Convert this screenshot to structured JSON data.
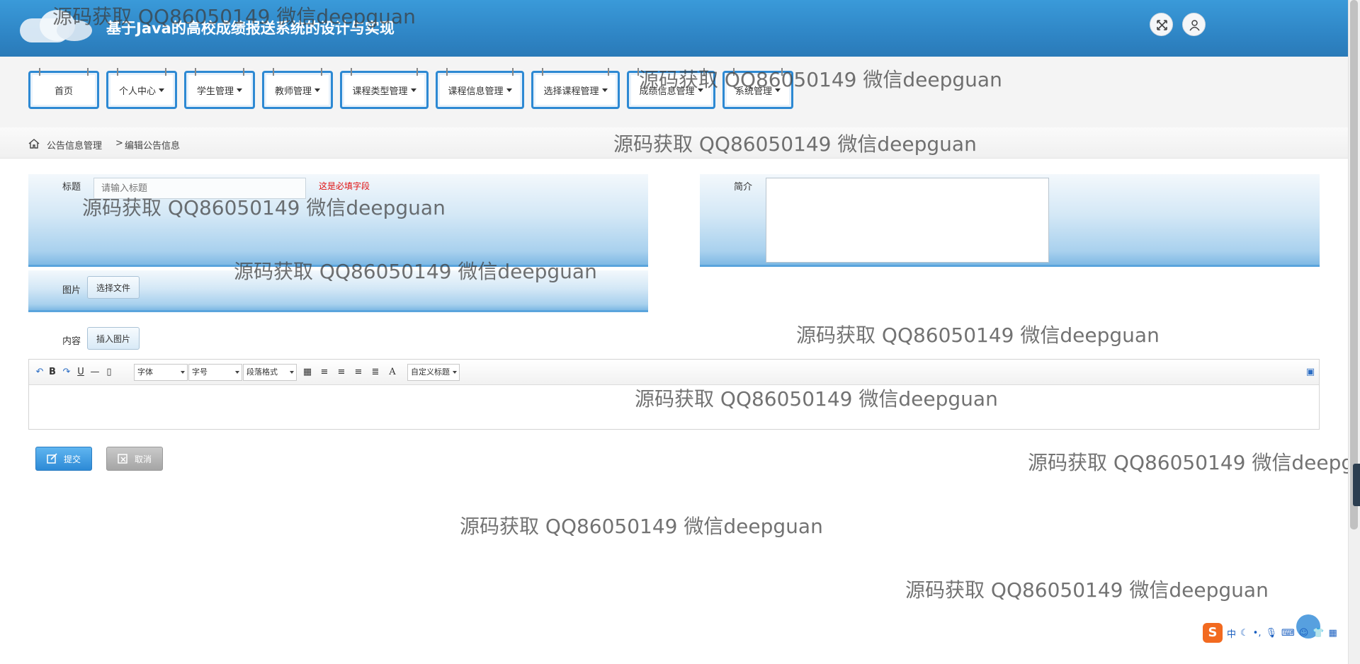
{
  "header": {
    "title": "基于Java的高校成绩报送系统的设计与实现"
  },
  "nav": {
    "items": [
      {
        "label": "首页",
        "dropdown": false
      },
      {
        "label": "个人中心",
        "dropdown": true
      },
      {
        "label": "学生管理",
        "dropdown": true
      },
      {
        "label": "教师管理",
        "dropdown": true
      },
      {
        "label": "课程类型管理",
        "dropdown": true
      },
      {
        "label": "课程信息管理",
        "dropdown": true
      },
      {
        "label": "选择课程管理",
        "dropdown": true
      },
      {
        "label": "成绩信息管理",
        "dropdown": true
      },
      {
        "label": "系统管理",
        "dropdown": true
      }
    ]
  },
  "breadcrumb": {
    "section": "公告信息管理",
    "separator": ">",
    "page": "编辑公告信息"
  },
  "form": {
    "title_label": "标题",
    "title_placeholder": "请输入标题",
    "title_required": "这是必填字段",
    "intro_label": "简介",
    "image_label": "图片",
    "choose_file": "选择文件",
    "content_label": "内容",
    "insert_image": "插入图片"
  },
  "editor": {
    "font_select": "字体",
    "size_select": "字号",
    "paragraph_select": "段落格式",
    "custom_title_select": "自定义标题"
  },
  "actions": {
    "submit": "提交",
    "cancel": "取消"
  },
  "watermark": {
    "text": "源码获取 QQ86050149 微信deepguan"
  },
  "ime": {
    "logo": "S",
    "mode": "中"
  },
  "colors": {
    "header": "#2f86c6",
    "nav_border": "#2d89d3",
    "required": "#e01010",
    "submit": "#2d8ad6",
    "cancel": "#a5a5a5"
  }
}
